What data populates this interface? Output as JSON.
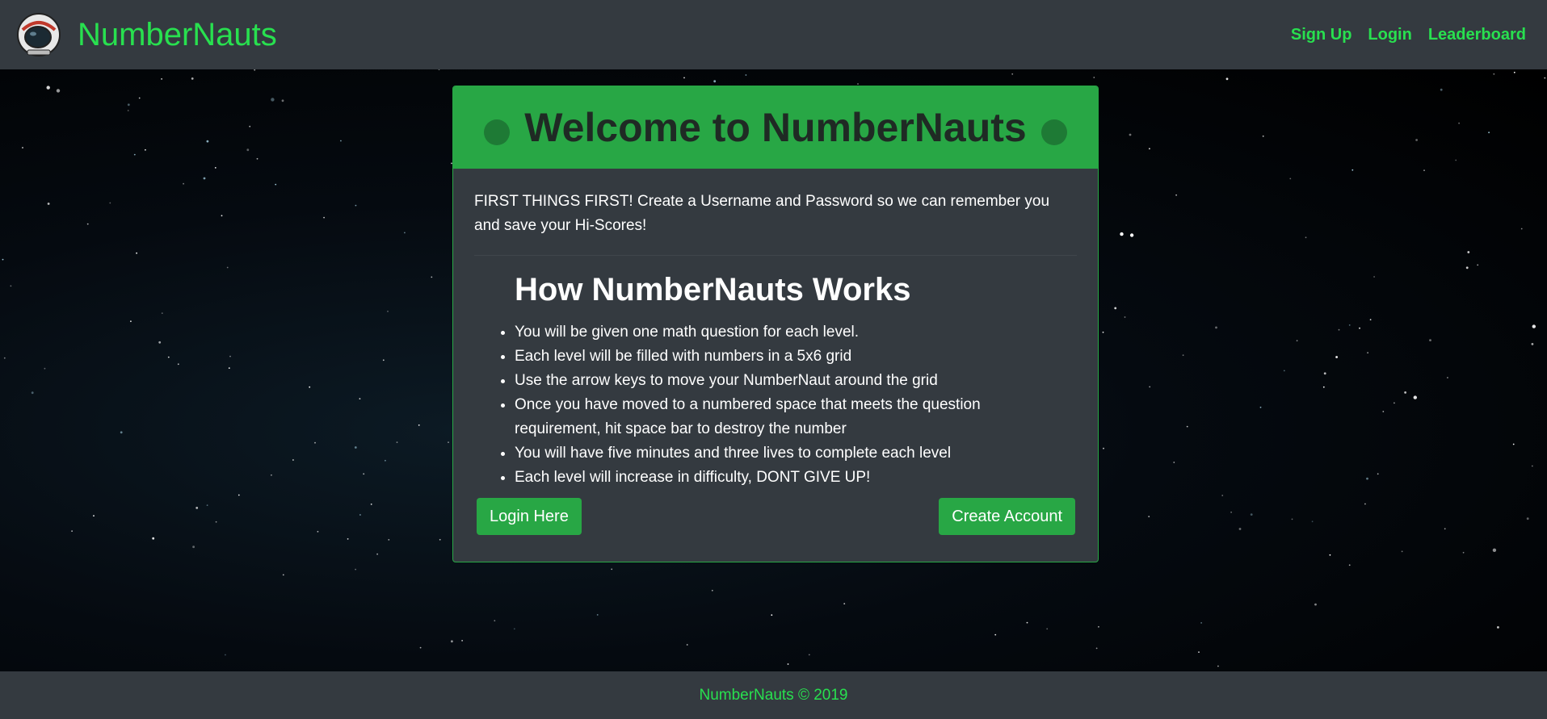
{
  "nav": {
    "brand": "NumberNauts",
    "links": [
      {
        "label": "Sign Up"
      },
      {
        "label": "Login"
      },
      {
        "label": "Leaderboard"
      }
    ]
  },
  "card": {
    "title": "Welcome to NumberNauts",
    "intro": "FIRST THINGS FIRST! Create a Username and Password so we can remember you and save your Hi-Scores!",
    "how_title": "How NumberNauts Works",
    "rules": [
      "You will be given one math question for each level.",
      "Each level will be filled with numbers in a 5x6 grid",
      "Use the arrow keys to move your NumberNaut around the grid",
      "Once you have moved to a numbered space that meets the question requirement, hit space bar to destroy the number",
      "You will have five minutes and three lives to complete each level",
      "Each level will increase in difficulty, DONT GIVE UP!"
    ],
    "login_button": "Login Here",
    "create_button": "Create Account"
  },
  "footer": {
    "text": "NumberNauts © 2019"
  },
  "icons": {
    "logo": "astronaut-helmet-icon",
    "title_dots": "circle-icon"
  },
  "colors": {
    "accent": "#28a745",
    "brand_text": "#28e04f",
    "navbar_bg": "#343a40",
    "card_bg": "#343a40"
  }
}
